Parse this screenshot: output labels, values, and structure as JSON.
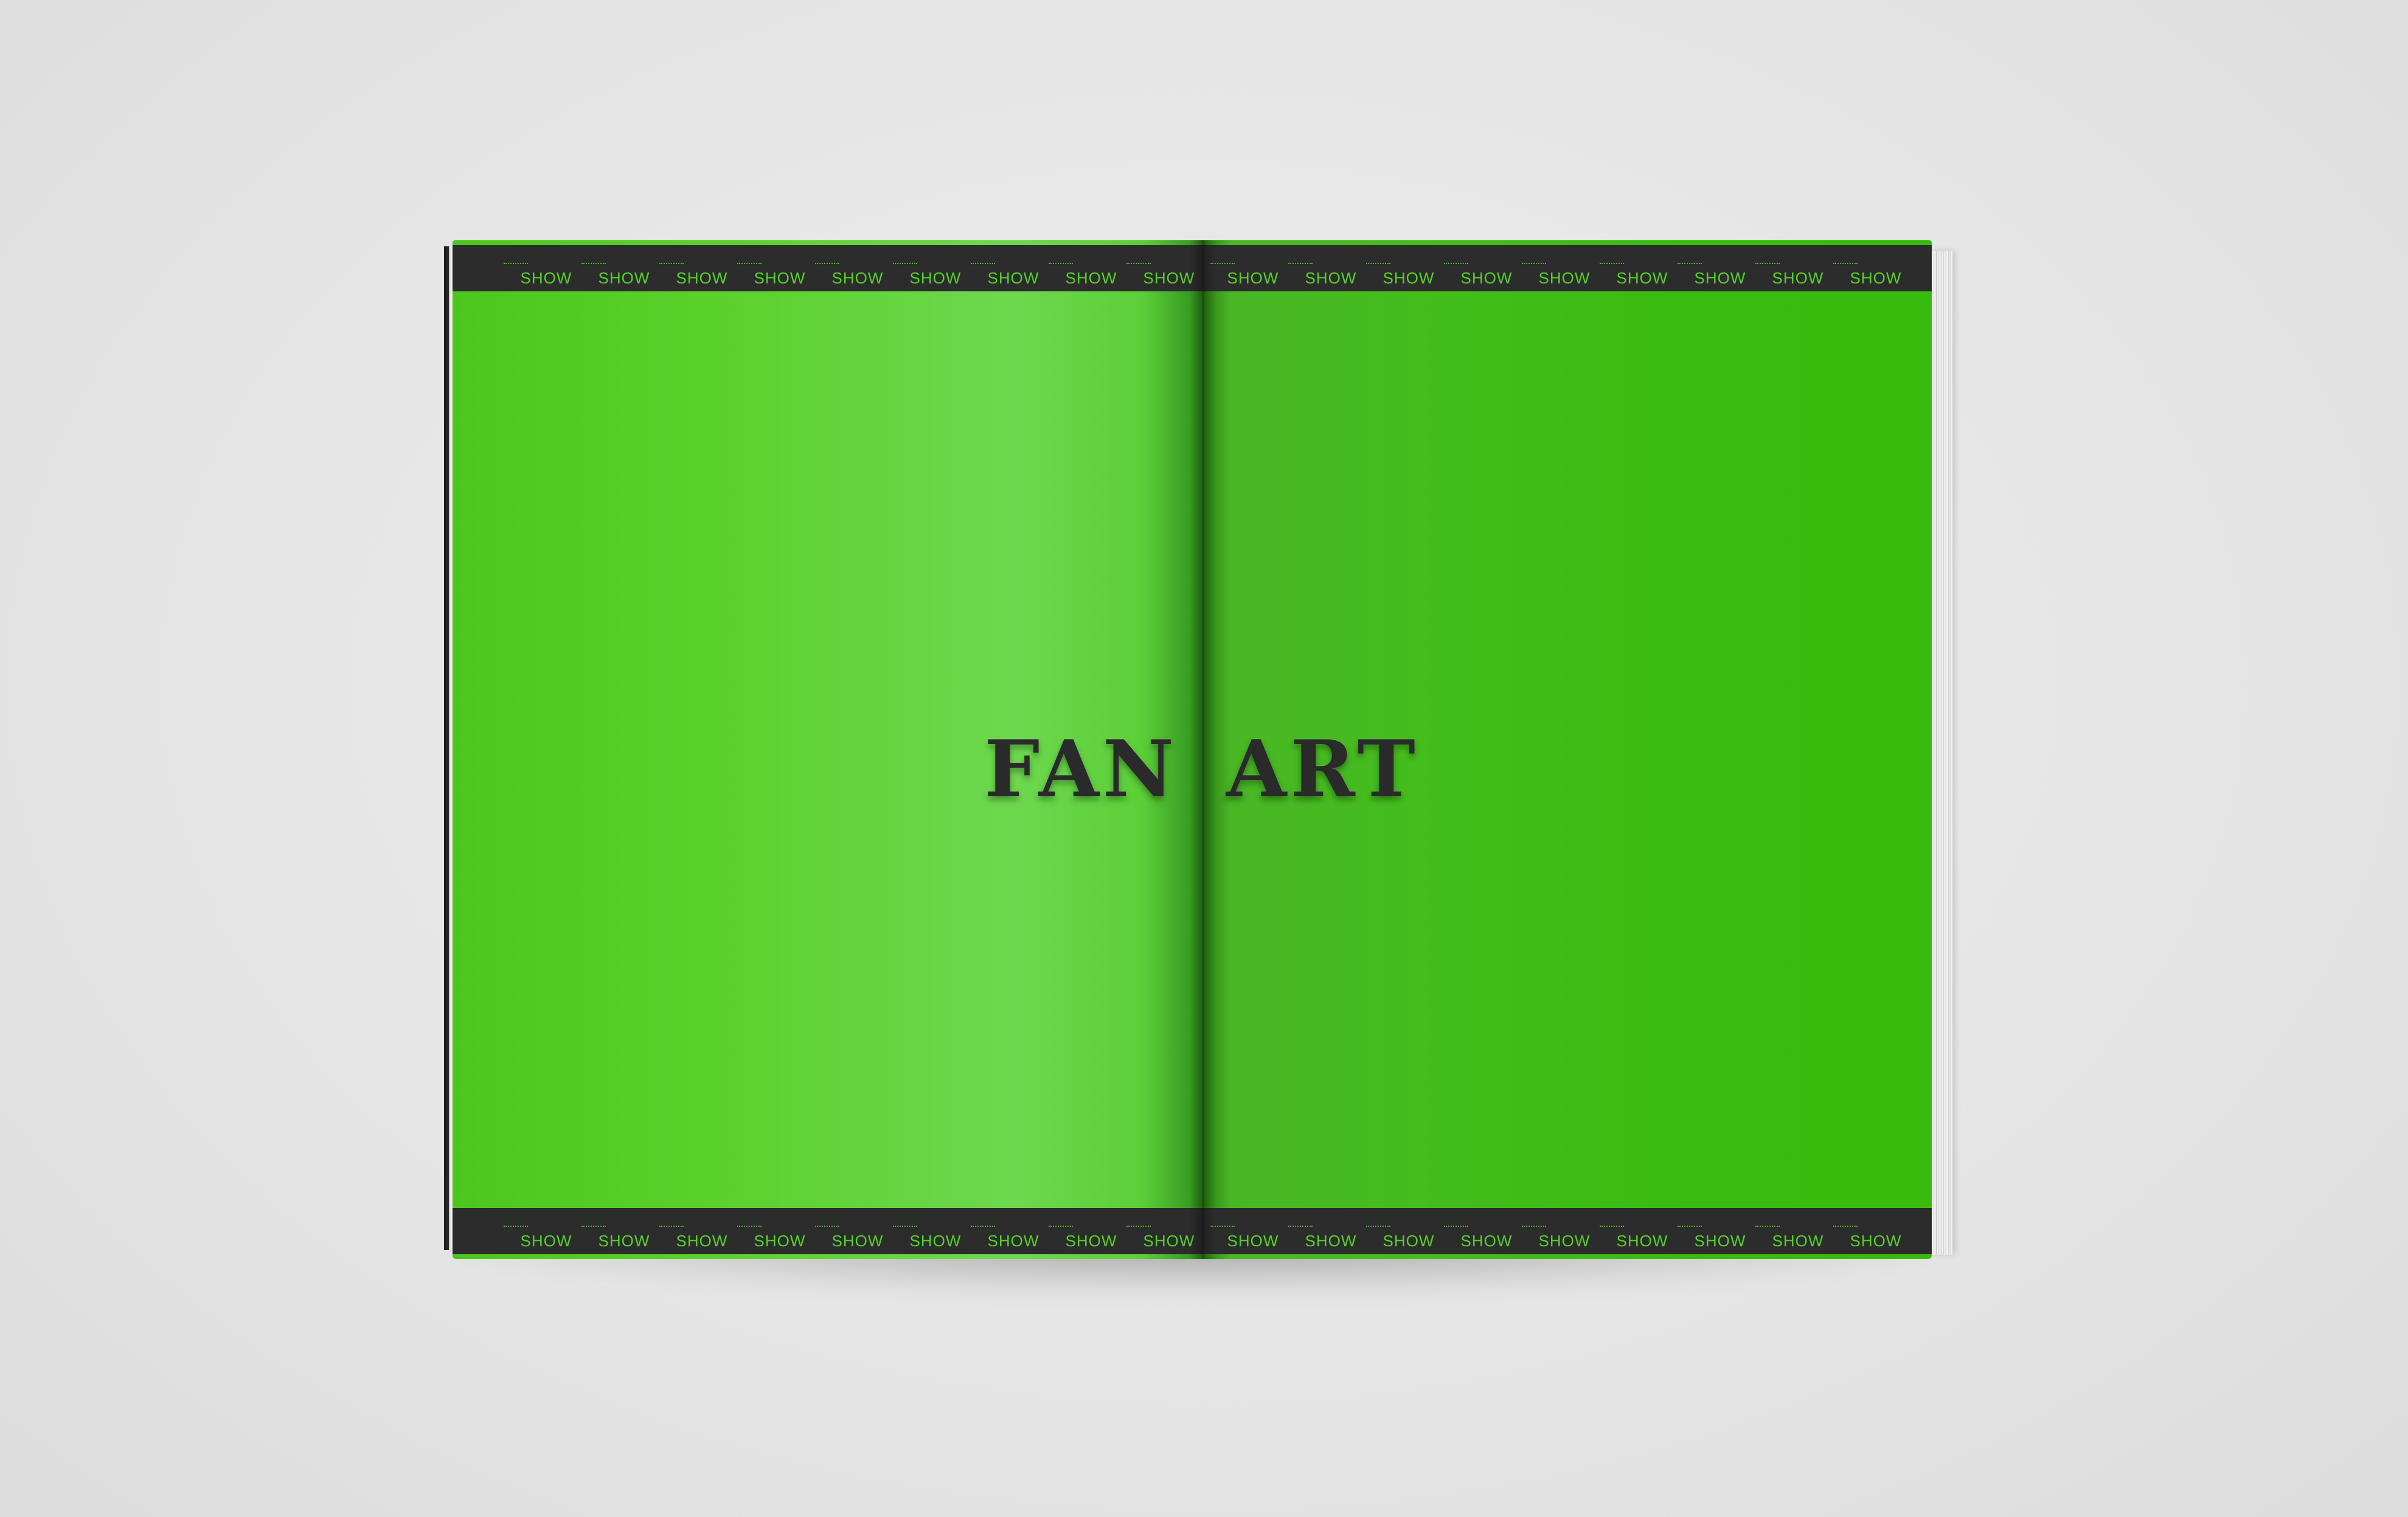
{
  "spread": {
    "band_word": "SHOW",
    "title_left": "FAN",
    "title_right": "ART"
  },
  "colors": {
    "page_green": "#45c01c",
    "band_black": "#2c2c2c",
    "band_text": "#56d12a",
    "title_text": "#2a2a2a",
    "background": "#e8e8e8"
  }
}
